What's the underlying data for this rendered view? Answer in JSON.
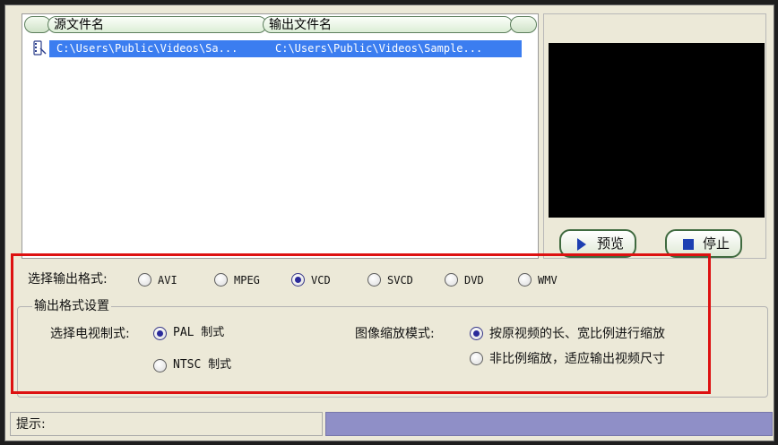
{
  "file_list": {
    "columns": [
      "源文件名",
      "输出文件名"
    ],
    "rows": [
      {
        "source": "C:\\Users\\Public\\Videos\\Sa...",
        "output": "C:\\Users\\Public\\Videos\\Sample..."
      }
    ]
  },
  "preview": {
    "preview_label": "预览",
    "stop_label": "停止"
  },
  "output_format": {
    "label": "选择输出格式:",
    "options": [
      "AVI",
      "MPEG",
      "VCD",
      "SVCD",
      "DVD",
      "WMV"
    ],
    "selected": "VCD"
  },
  "format_settings": {
    "title": "输出格式设置",
    "tv_system": {
      "label": "选择电视制式:",
      "options": [
        "PAL  制式",
        "NTSC 制式"
      ],
      "selected": "PAL  制式"
    },
    "scale_mode": {
      "label": "图像缩放模式:",
      "options": [
        "按原视频的长、宽比例进行缩放",
        "非比例缩放，适应输出视频尺寸"
      ],
      "selected": "按原视频的长、宽比例进行缩放"
    }
  },
  "status_bar": {
    "label": "提示:",
    "text": ""
  },
  "colors": {
    "selection": "#3b7df0",
    "highlight_box": "#dd1111",
    "status_fill": "#8f8fc7",
    "window_bg": "#ece9d8"
  },
  "icons": {
    "file_row": "film-clip-icon",
    "preview": "play-icon",
    "stop": "stop-icon"
  }
}
